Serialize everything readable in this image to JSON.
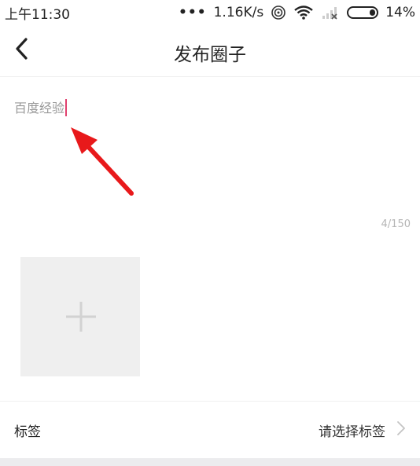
{
  "status_bar": {
    "time": "上午11:30",
    "more_dots": "•••",
    "network_speed": "1.16K/s",
    "battery_percent": "14%",
    "icons": [
      "hotspot-icon",
      "wifi-icon",
      "signal-icon",
      "battery-icon"
    ]
  },
  "header": {
    "back_icon": "chevron-left-icon",
    "title": "发布圈子"
  },
  "post": {
    "input_text": "百度经验",
    "char_count": "4/150"
  },
  "media": {
    "add_icon": "plus-icon"
  },
  "tags": {
    "label": "标签",
    "value": "请选择标签",
    "chevron_icon": "chevron-right-icon"
  },
  "colors": {
    "cursor": "#e0406e",
    "annotation_arrow": "#e8191b",
    "placeholder_gray": "#efefef"
  }
}
